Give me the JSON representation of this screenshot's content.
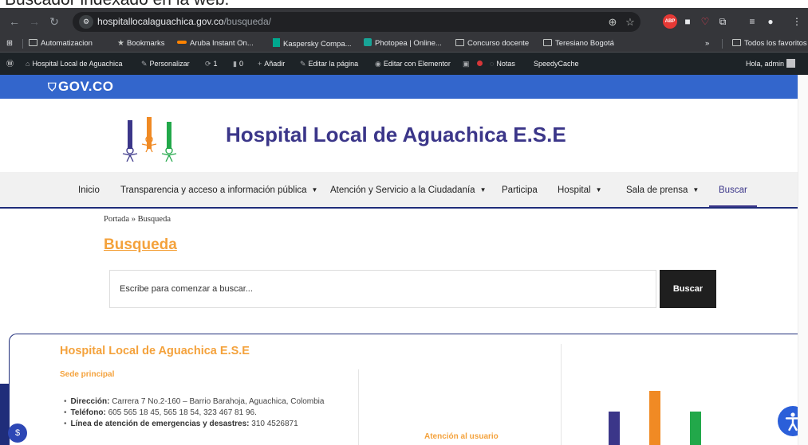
{
  "caption": "Buscador indexado en la web.",
  "browser": {
    "url_host": "hospitallocalaguachica.gov.co",
    "url_path": "/busqueda/",
    "bookmarks": [
      "Automatizacion",
      "Bookmarks",
      "Aruba Instant On...",
      "Kaspersky Compa...",
      "Photopea | Online...",
      "Concurso docente",
      "Teresiano Bogotá"
    ],
    "bookmarks_overflow": "»",
    "all_bookmarks": "Todos los favoritos"
  },
  "adminbar": {
    "site": "Hospital Local de Aguachica",
    "customize": "Personalizar",
    "updates": "1",
    "comments": "0",
    "new": "Añadir",
    "edit_page": "Editar la página",
    "elementor": "Editar con Elementor",
    "notes": "Notas",
    "cache": "SpeedyCache",
    "greeting": "Hola, admin"
  },
  "gov": {
    "logo": "GOV.CO"
  },
  "header": {
    "title": "Hospital Local de Aguachica E.S.E"
  },
  "menu": {
    "items": [
      {
        "label": "Inicio",
        "caret": ""
      },
      {
        "label": "Transparencia y acceso a información pública",
        "caret": "▼"
      },
      {
        "label": "Atención y Servicio a la Ciudadanía",
        "caret": "▼"
      },
      {
        "label": "Participa",
        "caret": ""
      },
      {
        "label": "Hospital",
        "caret": "▼"
      },
      {
        "label": "Sala de prensa",
        "caret": "▼"
      },
      {
        "label": "Buscar",
        "caret": ""
      }
    ]
  },
  "breadcrumb": "Portada » Busqueda",
  "page_title": "Busqueda",
  "search": {
    "placeholder": "Escribe para comenzar a buscar...",
    "button": "Buscar"
  },
  "footer": {
    "title": "Hospital Local de Aguachica E.S.E",
    "subtitle": "Sede principal",
    "info": [
      {
        "label": "Dirección:",
        "value": "Carrera 7 No.2-160 – Barrio Barahoja, Aguachica, Colombia"
      },
      {
        "label": "Teléfono:",
        "value": "605 565 18 45, 565 18 54, 323 467 81 96."
      },
      {
        "label": "Línea de atención de emergencias y desastres:",
        "value": "310 4526871"
      }
    ],
    "col2_title": "Atención al usuario"
  },
  "colors": {
    "primary": "#3b3689",
    "accent": "#f4a23c",
    "gov_blue": "#3366cc",
    "admin_bar": "#1d2327",
    "chrome": "#35363a",
    "logo_blue": "#3b3689",
    "logo_orange": "#f08a24",
    "logo_green": "#22a84a"
  }
}
